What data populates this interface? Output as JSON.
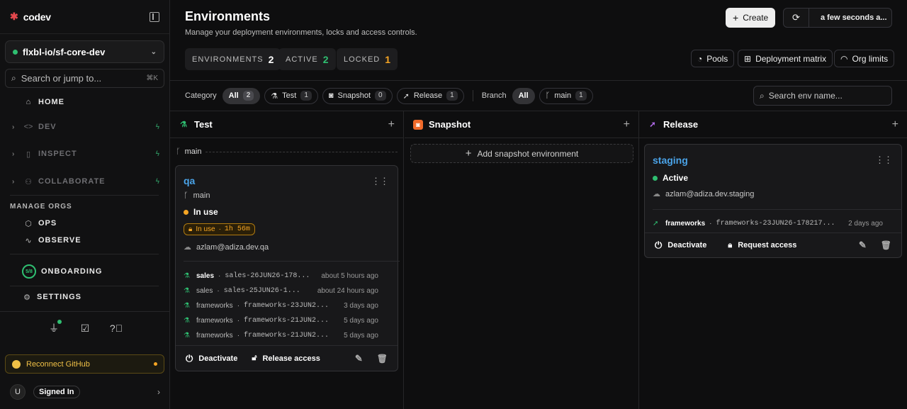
{
  "sidebar": {
    "brand": "codev",
    "org": "flxbl-io/sf-core-dev",
    "search_placeholder": "Search or jump to...",
    "search_kbd": "⌘K",
    "nav": {
      "home": "HOME",
      "dev": "DEV",
      "inspect": "INSPECT",
      "collaborate": "COLLABORATE",
      "section_manage": "MANAGE ORGS",
      "ops": "OPS",
      "observe": "OBSERVE",
      "onboarding": "ONBOARDING",
      "onboarding_progress": "5/8",
      "settings": "SETTINGS"
    },
    "reconnect": "Reconnect GitHub",
    "user_initial": "U",
    "user_status": "Signed In"
  },
  "header": {
    "title": "Environments",
    "subtitle": "Manage your deployment environments, locks and access controls.",
    "create": "Create",
    "refresh_label": "a few seconds a...",
    "stats": [
      {
        "label": "ENVIRONMENTS",
        "value": "2",
        "color": "#ffffff"
      },
      {
        "label": "ACTIVE",
        "value": "2",
        "color": "#2fbf71"
      },
      {
        "label": "LOCKED",
        "value": "1",
        "color": "#f5a524"
      }
    ],
    "pools": "Pools",
    "matrix": "Deployment matrix",
    "limits": "Org limits"
  },
  "filters": {
    "category_label": "Category",
    "categories": [
      {
        "label": "All",
        "count": "2"
      },
      {
        "label": "Test",
        "count": "1"
      },
      {
        "label": "Snapshot",
        "count": "0"
      },
      {
        "label": "Release",
        "count": "1"
      }
    ],
    "branch_label": "Branch",
    "branch_all": "All",
    "branch_main": "main",
    "branch_main_count": "1",
    "search_placeholder": "Search env name..."
  },
  "columns": {
    "test": {
      "title": "Test",
      "branch": "main",
      "card": {
        "name": "qa",
        "branch": "main",
        "status": "In use",
        "lock_text": "In use",
        "lock_time": "1h 56m",
        "user": "azlam@adiza.dev.qa",
        "deployments": [
          {
            "pkg": "sales",
            "ver": "sales-26JUN26-178...",
            "when": "about 5 hours ago"
          },
          {
            "pkg": "sales",
            "ver": "sales-25JUN26-1...",
            "when": "about 24 hours ago"
          },
          {
            "pkg": "frameworks",
            "ver": "frameworks-23JUN2...",
            "when": "3 days ago"
          },
          {
            "pkg": "frameworks",
            "ver": "frameworks-21JUN2...",
            "when": "5 days ago"
          },
          {
            "pkg": "frameworks",
            "ver": "frameworks-21JUN2...",
            "when": "5 days ago"
          }
        ],
        "deactivate": "Deactivate",
        "access": "Release access"
      }
    },
    "snapshot": {
      "title": "Snapshot",
      "add": "Add snapshot environment"
    },
    "release": {
      "title": "Release",
      "card": {
        "name": "staging",
        "status": "Active",
        "user": "azlam@adiza.dev.staging",
        "deploy_pkg": "frameworks",
        "deploy_ver": "frameworks-23JUN26-178217...",
        "deploy_when": "2 days ago",
        "deactivate": "Deactivate",
        "access": "Request access"
      }
    }
  }
}
